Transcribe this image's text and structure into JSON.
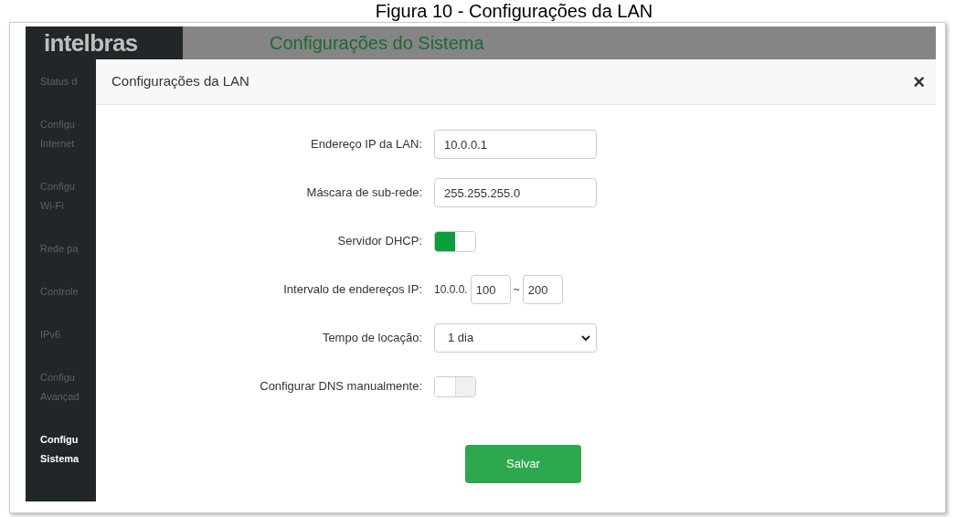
{
  "caption": "Figura 10 - Configurações da LAN",
  "header": {
    "logo": "intelbras",
    "title": "Configurações do Sistema"
  },
  "sidebar": {
    "items": [
      {
        "lines": [
          "Status d"
        ],
        "selected": false
      },
      {
        "lines": [
          "Configu",
          "Internet"
        ],
        "selected": false
      },
      {
        "lines": [
          "Configu",
          "Wi-Fi"
        ],
        "selected": false
      },
      {
        "lines": [
          "Rede pa"
        ],
        "selected": false
      },
      {
        "lines": [
          "Controle"
        ],
        "selected": false
      },
      {
        "lines": [
          "IPv6"
        ],
        "selected": false
      },
      {
        "lines": [
          "Configu",
          "Avançad"
        ],
        "selected": false
      },
      {
        "lines": [
          "Configu",
          "Sistema"
        ],
        "selected": true
      }
    ]
  },
  "dialog": {
    "title": "Configurações da LAN",
    "close": "×",
    "fields": [
      {
        "kind": "text",
        "label": "Endereço IP da LAN:",
        "value": "10.0.0.1"
      },
      {
        "kind": "text",
        "label": "Máscara de sub-rede:",
        "value": "255.255.255.0"
      },
      {
        "kind": "toggle",
        "label": "Servidor DHCP:",
        "on": true
      },
      {
        "kind": "range",
        "label": "Intervalo de endereços IP:",
        "prefix": "10.0.0.",
        "start": "100",
        "separator": "~",
        "end": "200"
      },
      {
        "kind": "select",
        "label": "Tempo de locação:",
        "value": "1 dia"
      },
      {
        "kind": "toggle",
        "label": "Configurar DNS manualmente:",
        "on": false
      }
    ],
    "save": "Salvar"
  }
}
